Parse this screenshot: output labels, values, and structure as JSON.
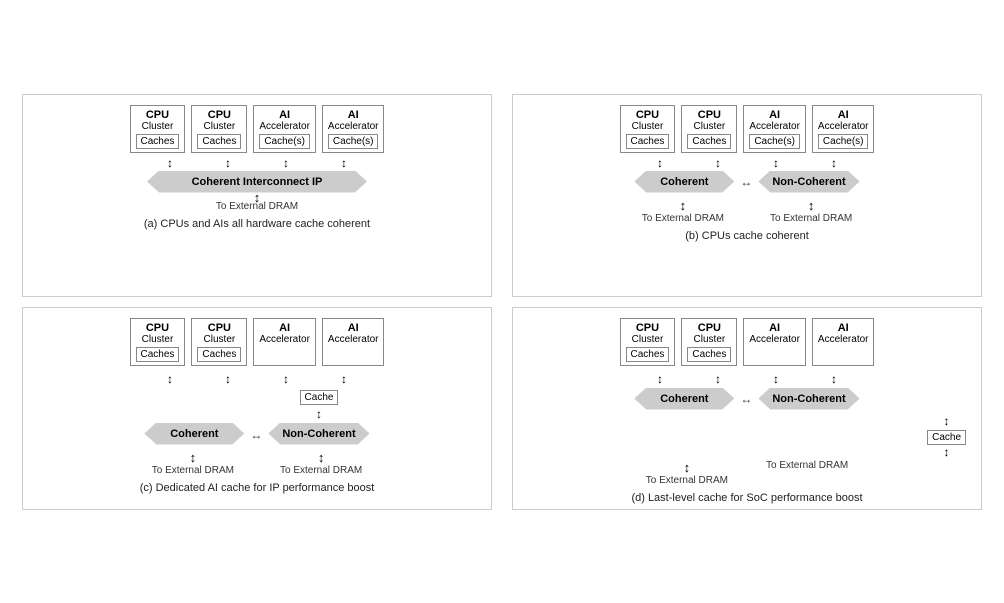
{
  "diagrams": [
    {
      "id": "a",
      "caption": "(a) CPUs and AIs all hardware cache coherent",
      "clusters": [
        {
          "title": "CPU",
          "subtitle": "Cluster",
          "cache": "Caches"
        },
        {
          "title": "CPU",
          "subtitle": "Cluster",
          "cache": "Caches"
        },
        {
          "title": "AI",
          "subtitle": "Accelerator",
          "cache": "Cache(s)"
        },
        {
          "title": "AI",
          "subtitle": "Accelerator",
          "cache": "Cache(s)"
        }
      ],
      "type": "single",
      "interconnect": "Coherent Interconnect IP",
      "dram": [
        "To External DRAM"
      ]
    },
    {
      "id": "b",
      "caption": "(b) CPUs cache coherent",
      "clusters": [
        {
          "title": "CPU",
          "subtitle": "Cluster",
          "cache": "Caches"
        },
        {
          "title": "CPU",
          "subtitle": "Cluster",
          "cache": "Caches"
        },
        {
          "title": "AI",
          "subtitle": "Accelerator",
          "cache": "Cache(s)"
        },
        {
          "title": "AI",
          "subtitle": "Accelerator",
          "cache": "Cache(s)"
        }
      ],
      "type": "double",
      "interconnect1": "Coherent",
      "interconnect2": "Non-Coherent",
      "dram": [
        "To External DRAM",
        "To External DRAM"
      ]
    },
    {
      "id": "c",
      "caption": "(c) Dedicated AI cache for IP performance boost",
      "clusters": [
        {
          "title": "CPU",
          "subtitle": "Cluster",
          "cache": "Caches"
        },
        {
          "title": "CPU",
          "subtitle": "Cluster",
          "cache": "Caches"
        },
        {
          "title": "AI",
          "subtitle": "Accelerator",
          "cache": null
        },
        {
          "title": "AI",
          "subtitle": "Accelerator",
          "cache": null
        }
      ],
      "type": "double-mid-cache",
      "interconnect1": "Coherent",
      "interconnect2": "Non-Coherent",
      "mid_cache": "Cache",
      "dram": [
        "To External DRAM",
        "To External DRAM"
      ]
    },
    {
      "id": "d",
      "caption": "(d) Last-level cache for SoC performance boost",
      "clusters": [
        {
          "title": "CPU",
          "subtitle": "Cluster",
          "cache": "Caches"
        },
        {
          "title": "CPU",
          "subtitle": "Cluster",
          "cache": "Caches"
        },
        {
          "title": "AI",
          "subtitle": "Accelerator",
          "cache": null
        },
        {
          "title": "AI",
          "subtitle": "Accelerator",
          "cache": null
        }
      ],
      "type": "double-bottom-cache",
      "interconnect1": "Coherent",
      "interconnect2": "Non-Coherent",
      "bottom_cache": "Cache",
      "dram": [
        "To External DRAM",
        "To External DRAM"
      ]
    }
  ]
}
